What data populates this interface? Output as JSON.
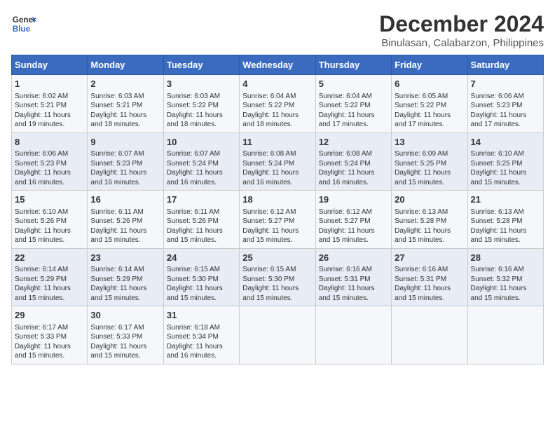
{
  "header": {
    "logo_line1": "General",
    "logo_line2": "Blue",
    "title": "December 2024",
    "subtitle": "Binulasan, Calabarzon, Philippines"
  },
  "columns": [
    "Sunday",
    "Monday",
    "Tuesday",
    "Wednesday",
    "Thursday",
    "Friday",
    "Saturday"
  ],
  "weeks": [
    [
      {
        "day": "1",
        "info": "Sunrise: 6:02 AM\nSunset: 5:21 PM\nDaylight: 11 hours\nand 19 minutes."
      },
      {
        "day": "2",
        "info": "Sunrise: 6:03 AM\nSunset: 5:21 PM\nDaylight: 11 hours\nand 18 minutes."
      },
      {
        "day": "3",
        "info": "Sunrise: 6:03 AM\nSunset: 5:22 PM\nDaylight: 11 hours\nand 18 minutes."
      },
      {
        "day": "4",
        "info": "Sunrise: 6:04 AM\nSunset: 5:22 PM\nDaylight: 11 hours\nand 18 minutes."
      },
      {
        "day": "5",
        "info": "Sunrise: 6:04 AM\nSunset: 5:22 PM\nDaylight: 11 hours\nand 17 minutes."
      },
      {
        "day": "6",
        "info": "Sunrise: 6:05 AM\nSunset: 5:22 PM\nDaylight: 11 hours\nand 17 minutes."
      },
      {
        "day": "7",
        "info": "Sunrise: 6:06 AM\nSunset: 5:23 PM\nDaylight: 11 hours\nand 17 minutes."
      }
    ],
    [
      {
        "day": "8",
        "info": "Sunrise: 6:06 AM\nSunset: 5:23 PM\nDaylight: 11 hours\nand 16 minutes."
      },
      {
        "day": "9",
        "info": "Sunrise: 6:07 AM\nSunset: 5:23 PM\nDaylight: 11 hours\nand 16 minutes."
      },
      {
        "day": "10",
        "info": "Sunrise: 6:07 AM\nSunset: 5:24 PM\nDaylight: 11 hours\nand 16 minutes."
      },
      {
        "day": "11",
        "info": "Sunrise: 6:08 AM\nSunset: 5:24 PM\nDaylight: 11 hours\nand 16 minutes."
      },
      {
        "day": "12",
        "info": "Sunrise: 6:08 AM\nSunset: 5:24 PM\nDaylight: 11 hours\nand 16 minutes."
      },
      {
        "day": "13",
        "info": "Sunrise: 6:09 AM\nSunset: 5:25 PM\nDaylight: 11 hours\nand 15 minutes."
      },
      {
        "day": "14",
        "info": "Sunrise: 6:10 AM\nSunset: 5:25 PM\nDaylight: 11 hours\nand 15 minutes."
      }
    ],
    [
      {
        "day": "15",
        "info": "Sunrise: 6:10 AM\nSunset: 5:26 PM\nDaylight: 11 hours\nand 15 minutes."
      },
      {
        "day": "16",
        "info": "Sunrise: 6:11 AM\nSunset: 5:26 PM\nDaylight: 11 hours\nand 15 minutes."
      },
      {
        "day": "17",
        "info": "Sunrise: 6:11 AM\nSunset: 5:26 PM\nDaylight: 11 hours\nand 15 minutes."
      },
      {
        "day": "18",
        "info": "Sunrise: 6:12 AM\nSunset: 5:27 PM\nDaylight: 11 hours\nand 15 minutes."
      },
      {
        "day": "19",
        "info": "Sunrise: 6:12 AM\nSunset: 5:27 PM\nDaylight: 11 hours\nand 15 minutes."
      },
      {
        "day": "20",
        "info": "Sunrise: 6:13 AM\nSunset: 5:28 PM\nDaylight: 11 hours\nand 15 minutes."
      },
      {
        "day": "21",
        "info": "Sunrise: 6:13 AM\nSunset: 5:28 PM\nDaylight: 11 hours\nand 15 minutes."
      }
    ],
    [
      {
        "day": "22",
        "info": "Sunrise: 6:14 AM\nSunset: 5:29 PM\nDaylight: 11 hours\nand 15 minutes."
      },
      {
        "day": "23",
        "info": "Sunrise: 6:14 AM\nSunset: 5:29 PM\nDaylight: 11 hours\nand 15 minutes."
      },
      {
        "day": "24",
        "info": "Sunrise: 6:15 AM\nSunset: 5:30 PM\nDaylight: 11 hours\nand 15 minutes."
      },
      {
        "day": "25",
        "info": "Sunrise: 6:15 AM\nSunset: 5:30 PM\nDaylight: 11 hours\nand 15 minutes."
      },
      {
        "day": "26",
        "info": "Sunrise: 6:16 AM\nSunset: 5:31 PM\nDaylight: 11 hours\nand 15 minutes."
      },
      {
        "day": "27",
        "info": "Sunrise: 6:16 AM\nSunset: 5:31 PM\nDaylight: 11 hours\nand 15 minutes."
      },
      {
        "day": "28",
        "info": "Sunrise: 6:16 AM\nSunset: 5:32 PM\nDaylight: 11 hours\nand 15 minutes."
      }
    ],
    [
      {
        "day": "29",
        "info": "Sunrise: 6:17 AM\nSunset: 5:33 PM\nDaylight: 11 hours\nand 15 minutes."
      },
      {
        "day": "30",
        "info": "Sunrise: 6:17 AM\nSunset: 5:33 PM\nDaylight: 11 hours\nand 15 minutes."
      },
      {
        "day": "31",
        "info": "Sunrise: 6:18 AM\nSunset: 5:34 PM\nDaylight: 11 hours\nand 16 minutes."
      },
      {
        "day": "",
        "info": ""
      },
      {
        "day": "",
        "info": ""
      },
      {
        "day": "",
        "info": ""
      },
      {
        "day": "",
        "info": ""
      }
    ]
  ]
}
